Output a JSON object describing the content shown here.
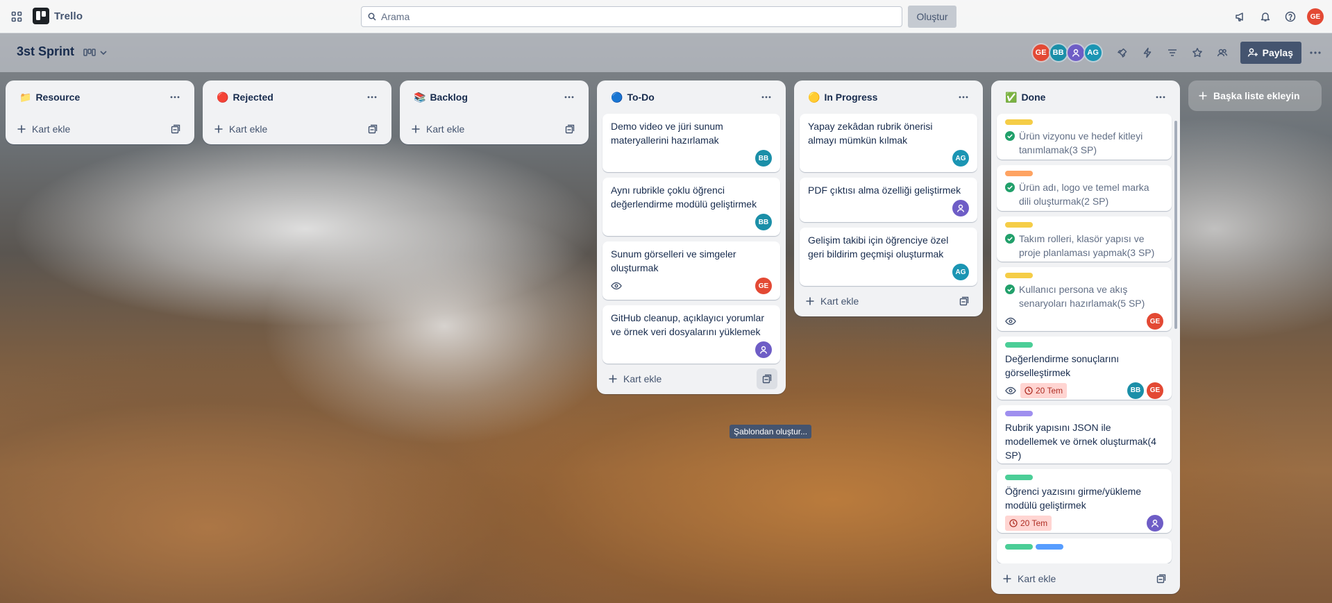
{
  "app": {
    "name": "Trello"
  },
  "topbar": {
    "search_placeholder": "Arama",
    "create_label": "Oluştur",
    "user_initials": "GE"
  },
  "board": {
    "title": "3st Sprint",
    "members": [
      {
        "initials": "GE",
        "color": "#e34934"
      },
      {
        "initials": "BB",
        "color": "#1b8fa8"
      },
      {
        "initials": "",
        "color": "#6e5dc6"
      },
      {
        "initials": "AG",
        "color": "#1b95b3"
      }
    ],
    "share_label": "Paylaş",
    "add_list_label": "Başka liste ekleyin"
  },
  "lists": [
    {
      "title": "Resource",
      "emoji": "📁",
      "add_label": "Kart ekle"
    },
    {
      "title": "Rejected",
      "emoji": "🔴",
      "add_label": "Kart ekle"
    },
    {
      "title": "Backlog",
      "emoji": "📚",
      "add_label": "Kart ekle"
    },
    {
      "title": "To-Do",
      "emoji": "🔵",
      "add_label": "Kart ekle",
      "cards": [
        {
          "title": "Demo video ve jüri sunum materyallerini hazırlamak",
          "member": "BB"
        },
        {
          "title": "Aynı rubrikle çoklu öğrenci değerlendirme modülü geliştirmek",
          "member": "BB"
        },
        {
          "title": "Sunum görselleri ve simgeler oluşturmak",
          "member": "GE"
        },
        {
          "title": "GitHub cleanup, açıklayıcı yorumlar ve örnek veri dosyalarını yüklemek",
          "member": ""
        }
      ]
    },
    {
      "title": "In Progress",
      "emoji": "🟡",
      "add_label": "Kart ekle",
      "cards": [
        {
          "title": "Yapay zekâdan rubrik önerisi almayı mümkün kılmak",
          "member": "AG"
        },
        {
          "title": "PDF çıktısı alma özelliği geliştirmek",
          "member": ""
        },
        {
          "title": "Gelişim takibi için öğrenciye özel geri bildirim geçmişi oluşturmak",
          "member": "AG"
        }
      ]
    },
    {
      "title": "Done",
      "emoji": "✅",
      "add_label": "Kart ekle",
      "cards": [
        {
          "title": "Ürün vizyonu ve hedef kitleyi tanımlamak(3 SP)",
          "label_color": "#f5cd47"
        },
        {
          "title": "Ürün adı, logo ve temel marka dili oluşturmak(2 SP)",
          "label_color": "#fea362"
        },
        {
          "title": "Takım rolleri, klasör yapısı ve proje planlaması yapmak(3 SP)",
          "label_color": "#f5cd47"
        },
        {
          "title": "Kullanıcı persona ve akış senaryoları hazırlamak(5 SP)",
          "label_color": "#f5cd47",
          "member": "GE"
        },
        {
          "title": "Değerlendirme sonuçlarını görselleştirmek",
          "label_color": "#4bce97",
          "due": "20 Tem",
          "members": [
            "BB",
            "GE"
          ]
        },
        {
          "title": "Rubrik yapısını JSON ile modellemek ve örnek oluşturmak(4 SP)",
          "label_color": "#9f8fef"
        },
        {
          "title": "Öğrenci yazısını girme/yükleme modülü geliştirmek",
          "label_color": "#4bce97",
          "due": "20 Tem"
        }
      ]
    }
  ],
  "tooltip": "Şablondan oluştur...",
  "colors": {
    "list_bg": "#f1f2f4",
    "header_btn": "#44546f",
    "due_bg": "#ffd5d2",
    "done_check": "#22a06b"
  }
}
